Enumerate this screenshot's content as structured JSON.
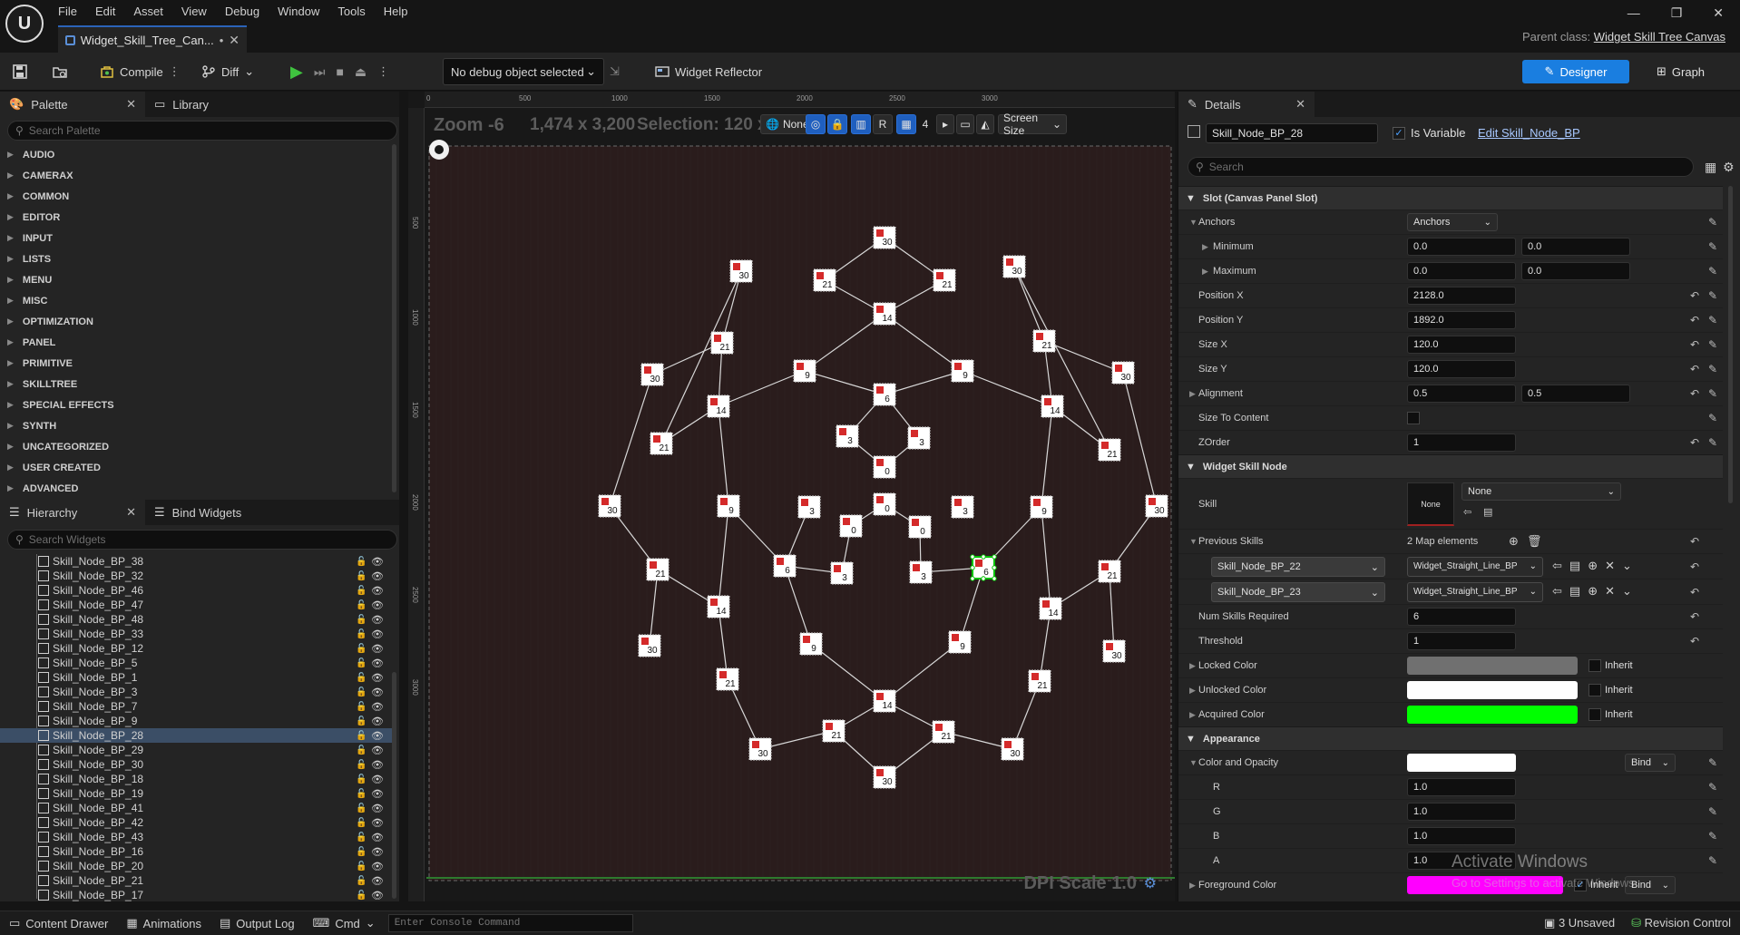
{
  "app": {
    "menu": [
      "File",
      "Edit",
      "Asset",
      "View",
      "Debug",
      "Window",
      "Tools",
      "Help"
    ],
    "doc_tab": "Widget_Skill_Tree_Can...",
    "parent_class_label": "Parent class:",
    "parent_class_value": "Widget Skill Tree Canvas",
    "window_controls": [
      "—",
      "❐",
      "✕"
    ]
  },
  "toolbar": {
    "compile": "Compile",
    "diff": "Diff",
    "debug_object": "No debug object selected",
    "widget_reflector": "Widget Reflector",
    "designer": "Designer",
    "graph": "Graph"
  },
  "palette": {
    "tab": "Palette",
    "library_tab": "Library",
    "search_placeholder": "Search Palette",
    "categories": [
      "AUDIO",
      "CAMERAX",
      "COMMON",
      "EDITOR",
      "INPUT",
      "LISTS",
      "MENU",
      "MISC",
      "OPTIMIZATION",
      "PANEL",
      "PRIMITIVE",
      "SKILLTREE",
      "SPECIAL EFFECTS",
      "SYNTH",
      "UNCATEGORIZED",
      "USER CREATED",
      "ADVANCED"
    ]
  },
  "hierarchy": {
    "tab": "Hierarchy",
    "bind_tab": "Bind Widgets",
    "search_placeholder": "Search Widgets",
    "items": [
      "Skill_Node_BP_38",
      "Skill_Node_BP_32",
      "Skill_Node_BP_46",
      "Skill_Node_BP_47",
      "Skill_Node_BP_48",
      "Skill_Node_BP_33",
      "Skill_Node_BP_12",
      "Skill_Node_BP_5",
      "Skill_Node_BP_1",
      "Skill_Node_BP_3",
      "Skill_Node_BP_7",
      "Skill_Node_BP_9",
      "Skill_Node_BP_28",
      "Skill_Node_BP_29",
      "Skill_Node_BP_30",
      "Skill_Node_BP_18",
      "Skill_Node_BP_19",
      "Skill_Node_BP_41",
      "Skill_Node_BP_42",
      "Skill_Node_BP_43",
      "Skill_Node_BP_16",
      "Skill_Node_BP_20",
      "Skill_Node_BP_21",
      "Skill_Node_BP_17"
    ],
    "selected_index": 12
  },
  "viewport": {
    "zoom": "Zoom -6",
    "resolution": "1,474 x 3,200",
    "selection": "Selection: 120 x 120",
    "none_label": "None",
    "r_label": "R",
    "grid_value": "4",
    "screen_size": "Screen Size",
    "dpi_scale": "DPI Scale 1.0",
    "ruler_top": [
      "0",
      "500",
      "1000",
      "1500",
      "2000",
      "2500",
      "3000"
    ],
    "ruler_left": [
      "500",
      "1000",
      "1500",
      "2000",
      "2500",
      "3000"
    ]
  },
  "skill_nodes": [
    {
      "label": "30"
    },
    {
      "label": "21"
    },
    {
      "label": "21"
    },
    {
      "label": "14"
    },
    {
      "label": "30"
    },
    {
      "label": "30"
    },
    {
      "label": "21"
    },
    {
      "label": "21"
    },
    {
      "label": "30"
    },
    {
      "label": "9"
    },
    {
      "label": "9"
    },
    {
      "label": "6"
    },
    {
      "label": "30"
    },
    {
      "label": "14"
    },
    {
      "label": "14"
    },
    {
      "label": "21"
    },
    {
      "label": "21"
    },
    {
      "label": "3"
    },
    {
      "label": "3"
    },
    {
      "label": "0"
    },
    {
      "label": "30"
    },
    {
      "label": "9"
    },
    {
      "label": "3"
    },
    {
      "label": "0"
    },
    {
      "label": "3"
    },
    {
      "label": "9"
    },
    {
      "label": "30"
    },
    {
      "label": "0"
    },
    {
      "label": "0"
    },
    {
      "label": "21"
    },
    {
      "label": "6"
    },
    {
      "label": "3"
    },
    {
      "label": "3"
    },
    {
      "label": "6"
    },
    {
      "label": "21"
    },
    {
      "label": "14"
    },
    {
      "label": "14"
    },
    {
      "label": "30"
    },
    {
      "label": "9"
    },
    {
      "label": "9"
    },
    {
      "label": "30"
    },
    {
      "label": "21"
    },
    {
      "label": "21"
    },
    {
      "label": "14"
    },
    {
      "label": "21"
    },
    {
      "label": "21"
    },
    {
      "label": "30"
    },
    {
      "label": "30"
    },
    {
      "label": "30"
    }
  ],
  "details": {
    "tab": "Details",
    "widget_name": "Skill_Node_BP_28",
    "is_variable": "Is Variable",
    "edit_link": "Edit Skill_Node_BP",
    "search_placeholder": "Search",
    "slot_section": "Slot (Canvas Panel Slot)",
    "anchors_label": "Anchors",
    "anchors_value": "Anchors",
    "minimum_label": "Minimum",
    "minimum": [
      "0.0",
      "0.0"
    ],
    "maximum_label": "Maximum",
    "maximum": [
      "0.0",
      "0.0"
    ],
    "position_x_label": "Position X",
    "position_x": "2128.0",
    "position_y_label": "Position Y",
    "position_y": "1892.0",
    "size_x_label": "Size X",
    "size_x": "120.0",
    "size_y_label": "Size Y",
    "size_y": "120.0",
    "alignment_label": "Alignment",
    "alignment": [
      "0.5",
      "0.5"
    ],
    "size_to_content_label": "Size To Content",
    "zorder_label": "ZOrder",
    "zorder": "1",
    "widget_section": "Widget Skill Node",
    "skill_label": "Skill",
    "skill_thumb": "None",
    "skill_value": "None",
    "prev_skills_label": "Previous Skills",
    "prev_skills_count": "2 Map elements",
    "map_entries": [
      {
        "key": "Skill_Node_BP_22",
        "value": "Widget_Straight_Line_BP"
      },
      {
        "key": "Skill_Node_BP_23",
        "value": "Widget_Straight_Line_BP"
      }
    ],
    "num_skills_label": "Num Skills Required",
    "num_skills": "6",
    "threshold_label": "Threshold",
    "threshold": "1",
    "locked_color_label": "Locked Color",
    "locked_color": "#707070",
    "unlocked_color_label": "Unlocked Color",
    "unlocked_color": "#ffffff",
    "acquired_color_label": "Acquired Color",
    "acquired_color": "#00ff00",
    "inherit_label": "Inherit",
    "appearance_section": "Appearance",
    "color_opacity_label": "Color and Opacity",
    "color_opacity": "#ffffff",
    "bind_label": "Bind",
    "r_label": "R",
    "r": "1.0",
    "g_label": "G",
    "g": "1.0",
    "b_label": "B",
    "b": "1.0",
    "a_label": "A",
    "a": "1.0",
    "foreground_label": "Foreground Color",
    "foreground_color": "#ff00ff"
  },
  "watermark": {
    "title": "Activate Windows",
    "subtitle": "Go to Settings to activate Windows."
  },
  "statusbar": {
    "content_drawer": "Content Drawer",
    "animations": "Animations",
    "output_log": "Output Log",
    "cmd": "Cmd",
    "console_placeholder": "Enter Console Command",
    "unsaved": "3 Unsaved",
    "revision_control": "Revision Control"
  },
  "colors": {
    "accent": "#1a7ee0",
    "canvas_bg": "#2a1c1c",
    "node_marker": "#d42a2a",
    "selection": "#00c000"
  }
}
